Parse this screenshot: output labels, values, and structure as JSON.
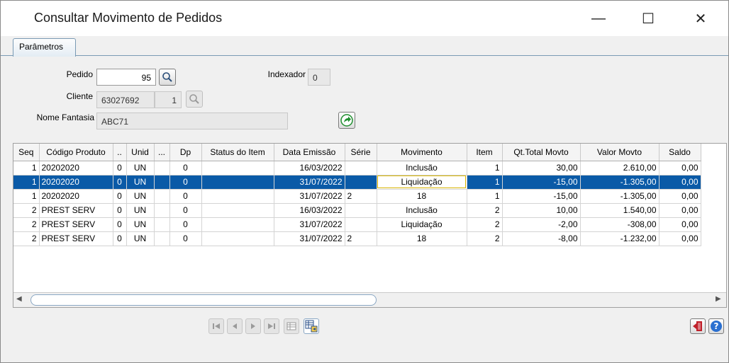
{
  "window": {
    "title": "Consultar Movimento de Pedidos",
    "minimize_glyph": "—",
    "maximize_glyph": "☐",
    "close_glyph": "✕"
  },
  "tabs": [
    {
      "label": "Parâmetros",
      "active": true
    }
  ],
  "form": {
    "pedido_label": "Pedido",
    "pedido_value": "95",
    "indexador_label": "Indexador",
    "indexador_value": "0",
    "cliente_label": "Cliente",
    "cliente_code": "63027692",
    "cliente_seq": "1",
    "nome_fantasia_label": "Nome Fantasia",
    "nome_fantasia_value": "ABC71"
  },
  "icons": {
    "search": "search-icon",
    "search_disabled": "search-disabled-icon",
    "forward": "green-arrow-icon",
    "exit": "exit-icon",
    "help": "help-icon"
  },
  "colors": {
    "selection": "#0a5aa7",
    "arrow_green": "#1f8f2f",
    "help_blue": "#2a6fd0",
    "exit_red": "#c0202a"
  },
  "grid": {
    "columns": [
      "Seq",
      "Código Produto",
      "..",
      "Unid",
      "...",
      "Dp",
      "Status do Item",
      "Data Emissão",
      "Série",
      "Movimento",
      "Item",
      "Qt.Total Movto",
      "Valor Movto",
      "Saldo"
    ],
    "rows": [
      [
        "1",
        "20202020",
        "0",
        "UN",
        "",
        "0",
        "",
        "16/03/2022",
        "",
        "Inclusão",
        "1",
        "30,00",
        "2.610,00",
        "0,00"
      ],
      [
        "1",
        "20202020",
        "0",
        "UN",
        "",
        "0",
        "",
        "31/07/2022",
        "",
        "Liquidação",
        "1",
        "-15,00",
        "-1.305,00",
        "0,00"
      ],
      [
        "1",
        "20202020",
        "0",
        "UN",
        "",
        "0",
        "",
        "31/07/2022",
        "2",
        "18",
        "1",
        "-15,00",
        "-1.305,00",
        "0,00"
      ],
      [
        "2",
        "PREST SERV",
        "0",
        "UN",
        "",
        "0",
        "",
        "16/03/2022",
        "",
        "Inclusão",
        "2",
        "10,00",
        "1.540,00",
        "0,00"
      ],
      [
        "2",
        "PREST SERV",
        "0",
        "UN",
        "",
        "0",
        "",
        "31/07/2022",
        "",
        "Liquidação",
        "2",
        "-2,00",
        "-308,00",
        "0,00"
      ],
      [
        "2",
        "PREST SERV",
        "0",
        "UN",
        "",
        "0",
        "",
        "31/07/2022",
        "2",
        "18",
        "2",
        "-8,00",
        "-1.232,00",
        "0,00"
      ]
    ],
    "selected_row": 1
  },
  "navigator": [
    "first-icon",
    "prior-icon",
    "next-icon",
    "last-icon",
    "grid-view-icon",
    "export-icon"
  ]
}
